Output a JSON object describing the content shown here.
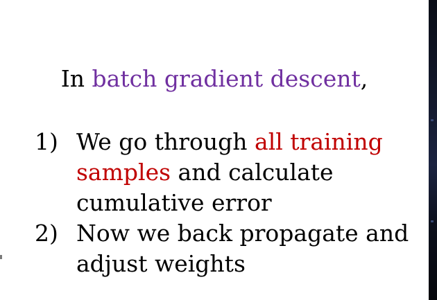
{
  "slide": {
    "heading": {
      "prefix": "In ",
      "highlight": "batch gradient descent",
      "suffix": ","
    },
    "list": [
      {
        "number": "1)",
        "lines": [
          {
            "text_before": "We go through ",
            "highlight": "all training",
            "text_after": ""
          },
          {
            "text_before": "",
            "highlight": "samples",
            "text_after": " and calculate"
          },
          {
            "text_before": "cumulative error",
            "highlight": "",
            "text_after": ""
          }
        ]
      },
      {
        "number": "2)",
        "lines": [
          {
            "text_before": "Now we back propagate and",
            "highlight": "",
            "text_after": ""
          },
          {
            "text_before": "adjust weights",
            "highlight": "",
            "text_after": ""
          }
        ]
      }
    ]
  },
  "colors": {
    "heading_highlight": "#7030a0",
    "list_highlight": "#c00000",
    "text": "#000000",
    "background": "#ffffff"
  }
}
